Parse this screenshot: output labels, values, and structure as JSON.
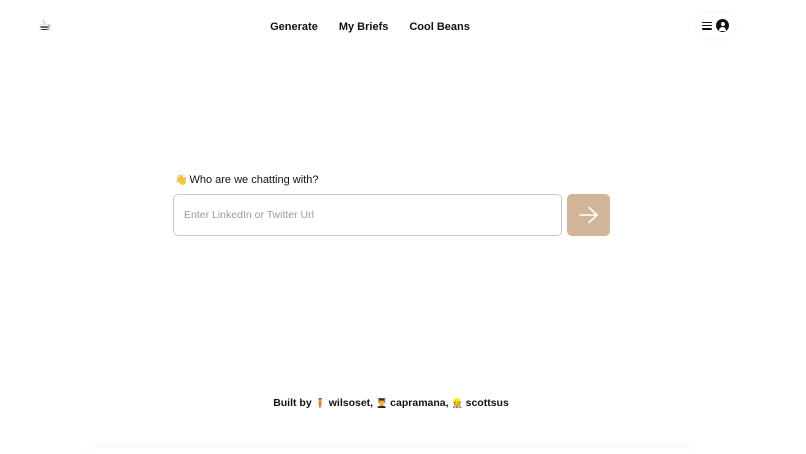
{
  "header": {
    "logo_glyph": "☕",
    "nav": [
      {
        "label": "Generate"
      },
      {
        "label": "My Briefs"
      },
      {
        "label": "Cool Beans"
      }
    ],
    "user_menu": {
      "icon_menu": "hamburger-icon",
      "icon_user": "user-avatar-icon"
    }
  },
  "main": {
    "prompt_emoji": "👋",
    "prompt_text": "Who are we chatting with?",
    "input": {
      "value": "",
      "placeholder": "Enter LinkedIn or Twitter Url"
    },
    "submit_icon": "arrow-right-icon",
    "submit_color": "#d2b498"
  },
  "footer": {
    "built_by": "Built by",
    "authors": [
      {
        "emoji": "🧍",
        "name": "wilsoset,"
      },
      {
        "emoji": "👨‍🎓",
        "name": "capramana,"
      },
      {
        "emoji": "👷",
        "name": "scottsus"
      }
    ]
  }
}
